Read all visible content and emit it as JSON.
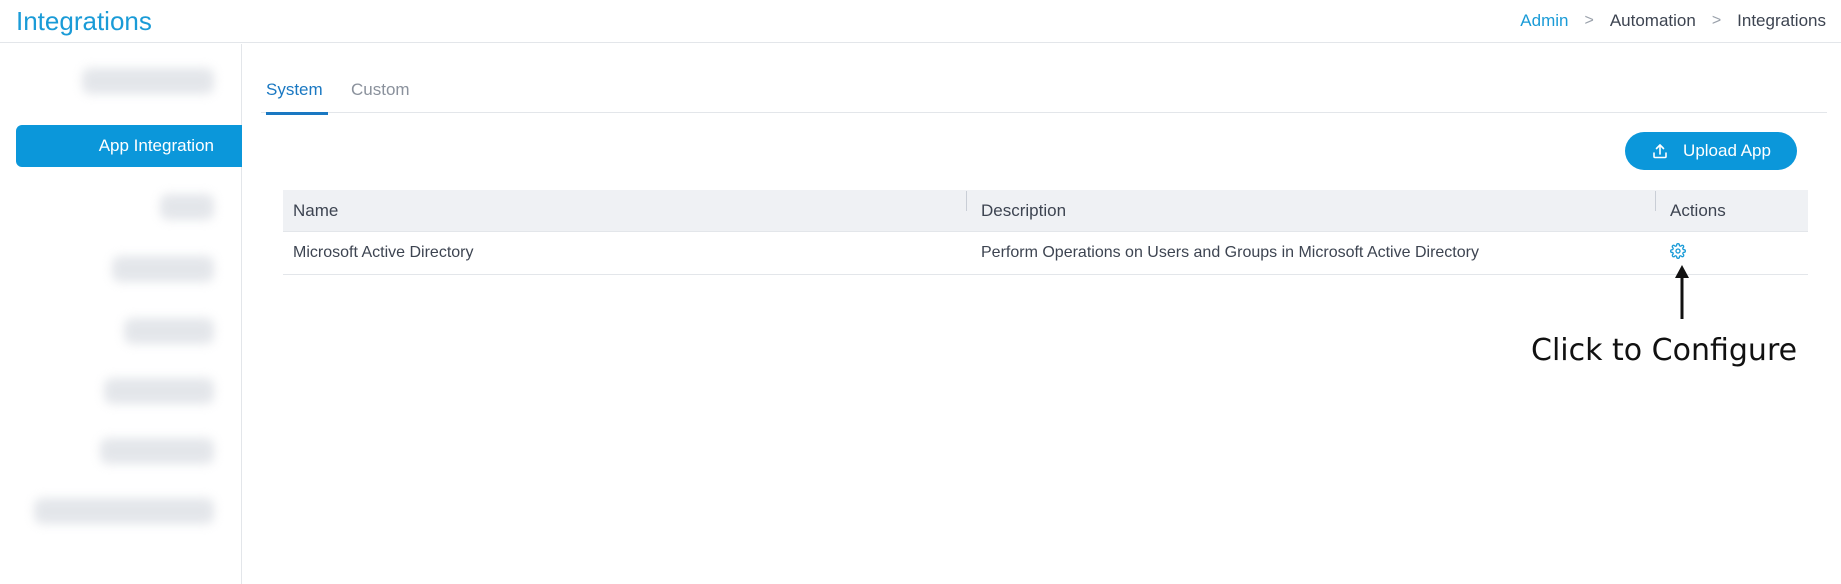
{
  "header": {
    "title": "Integrations",
    "breadcrumb": [
      "Admin",
      "Automation",
      "Integrations"
    ]
  },
  "sidebar": {
    "active_item": "App Integration"
  },
  "tabs": [
    {
      "label": "System",
      "active": true
    },
    {
      "label": "Custom",
      "active": false
    }
  ],
  "toolbar": {
    "upload_label": "Upload App",
    "upload_icon": "upload-icon"
  },
  "table": {
    "columns": [
      "Name",
      "Description",
      "Actions"
    ],
    "rows": [
      {
        "name": "Microsoft Active Directory",
        "description": "Perform Operations on Users and Groups in Microsoft Active Directory",
        "action_icon": "gear-icon"
      }
    ]
  },
  "annotation": {
    "text": "Click to Configure"
  },
  "colors": {
    "accent": "#0b97da",
    "title": "#1a9bd7",
    "tab_active": "#1a78c2"
  }
}
